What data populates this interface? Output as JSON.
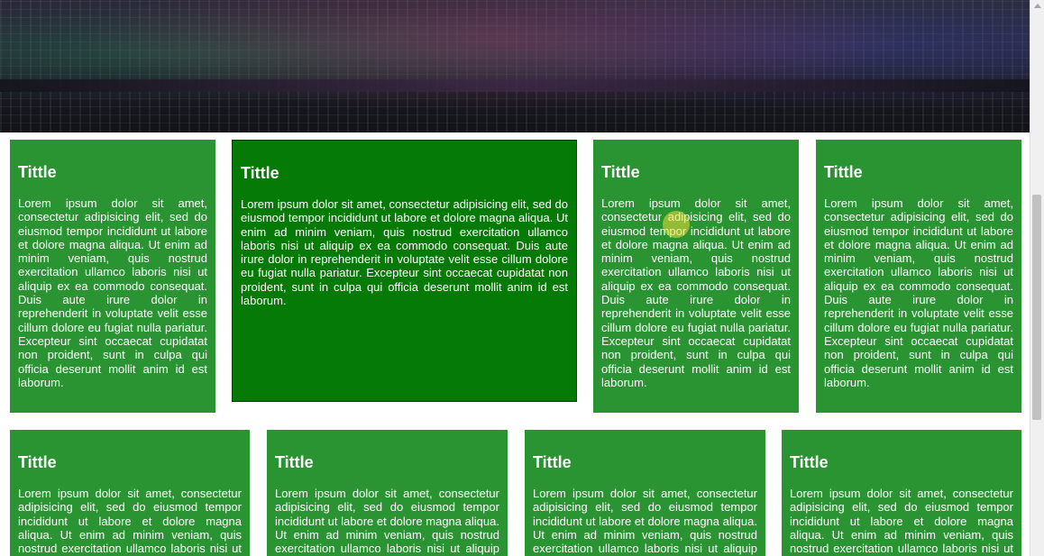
{
  "cards": [
    {
      "title": "Tittle",
      "text": "Lorem ipsum dolor sit amet, consectetur adipisicing elit, sed do eiusmod tempor incididunt ut labore et dolore magna aliqua. Ut enim ad minim veniam, quis nostrud exercitation ullamco laboris nisi ut aliquip ex ea commodo consequat. Duis aute irure dolor in reprehenderit in voluptate velit esse cillum dolore eu fugiat nulla pariatur. Excepteur sint occaecat cupidatat non proident, sunt in culpa qui officia deserunt mollit anim id est laborum."
    },
    {
      "title": "Tittle",
      "text": "Lorem ipsum dolor sit amet, consectetur adipisicing elit, sed do eiusmod tempor incididunt ut labore et dolore magna aliqua. Ut enim ad minim veniam, quis nostrud exercitation ullamco laboris nisi ut aliquip ex ea commodo consequat. Duis aute irure dolor in reprehenderit in voluptate velit esse cillum dolore eu fugiat nulla pariatur. Excepteur sint occaecat cupidatat non proident, sunt in culpa qui officia deserunt mollit anim id est laborum."
    },
    {
      "title": "Tittle",
      "text": "Lorem ipsum dolor sit amet, consectetur adipisicing elit, sed do eiusmod tempor incididunt ut labore et dolore magna aliqua. Ut enim ad minim veniam, quis nostrud exercitation ullamco laboris nisi ut aliquip ex ea commodo consequat. Duis aute irure dolor in reprehenderit in voluptate velit esse cillum dolore eu fugiat nulla pariatur. Excepteur sint occaecat cupidatat non proident, sunt in culpa qui officia deserunt mollit anim id est laborum."
    },
    {
      "title": "Tittle",
      "text": "Lorem ipsum dolor sit amet, consectetur adipisicing elit, sed do eiusmod tempor incididunt ut labore et dolore magna aliqua. Ut enim ad minim veniam, quis nostrud exercitation ullamco laboris nisi ut aliquip ex ea commodo consequat. Duis aute irure dolor in reprehenderit in voluptate velit esse cillum dolore eu fugiat nulla pariatur. Excepteur sint occaecat cupidatat non proident, sunt in culpa qui officia deserunt mollit anim id est laborum."
    },
    {
      "title": "Tittle",
      "text": "Lorem ipsum dolor sit amet, consectetur adipisicing elit, sed do eiusmod tempor incididunt ut labore et dolore magna aliqua. Ut enim ad minim veniam, quis nostrud exercitation ullamco laboris nisi ut aliquip ex ea commodo consequat."
    },
    {
      "title": "Tittle",
      "text": "Lorem ipsum dolor sit amet, consectetur adipisicing elit, sed do eiusmod tempor incididunt ut labore et dolore magna aliqua. Ut enim ad minim veniam, quis nostrud exercitation ullamco laboris nisi ut aliquip ex ea commodo consequat."
    },
    {
      "title": "Tittle",
      "text": "Lorem ipsum dolor sit amet, consectetur adipisicing elit, sed do eiusmod tempor incididunt ut labore et dolore magna aliqua. Ut enim ad minim veniam, quis nostrud exercitation ullamco laboris nisi ut aliquip ex ea commodo consequat."
    },
    {
      "title": "Tittle",
      "text": "Lorem ipsum dolor sit amet, consectetur adipisicing elit, sed do eiusmod tempor incididunt ut labore et dolore magna aliqua. Ut enim ad minim veniam, quis nostrud exercitation ullamco laboris nisi ut aliquip ex ea commodo consequat."
    }
  ],
  "colors": {
    "card_green": "#2a9432",
    "featured_green": "#067a06",
    "text": "#ffffff"
  }
}
